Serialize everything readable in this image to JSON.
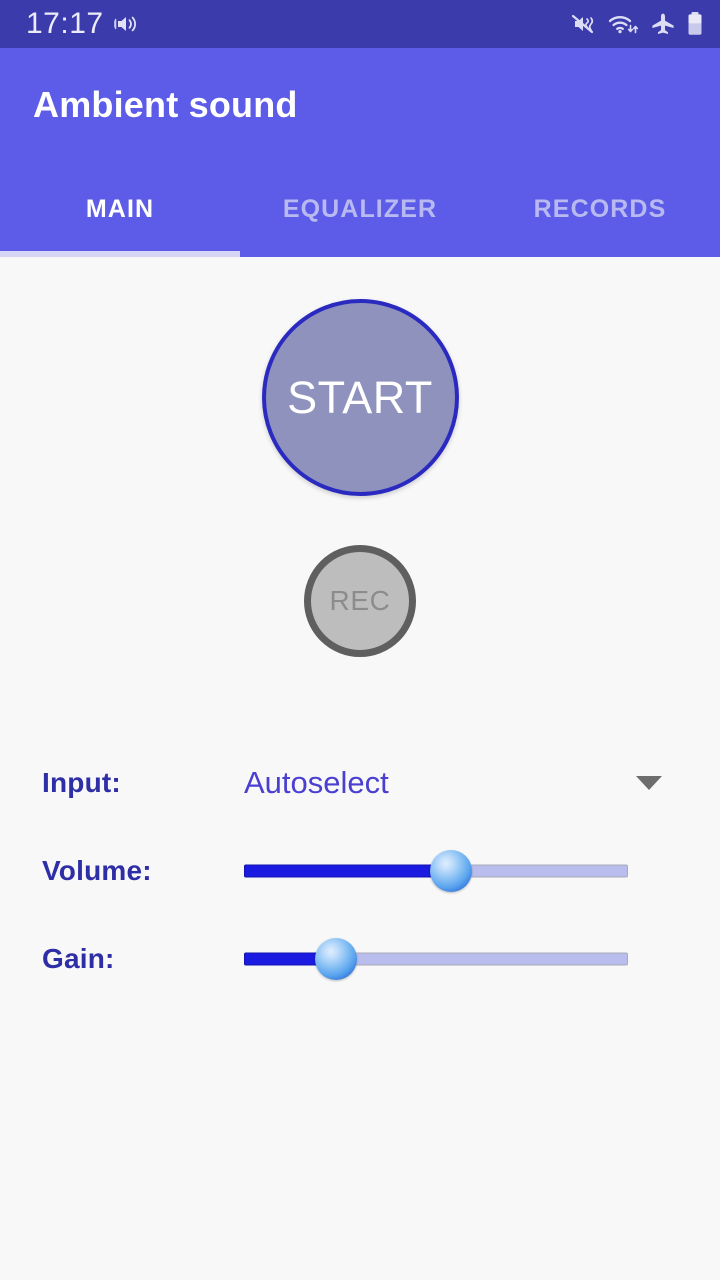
{
  "status_bar": {
    "clock": "17:17",
    "left_icons": [
      "sound-waves-icon"
    ],
    "right_icons": [
      "mute-vibrate-icon",
      "wifi-data-icon",
      "airplane-mode-icon",
      "battery-icon"
    ],
    "background": "#3b3bab"
  },
  "app_bar": {
    "title": "Ambient sound",
    "background": "#5c5ce8",
    "title_color": "#ffffff"
  },
  "tabs": {
    "items": [
      {
        "label": "MAIN",
        "active": true
      },
      {
        "label": "EQUALIZER",
        "active": false
      },
      {
        "label": "RECORDS",
        "active": false
      }
    ],
    "active_color": "#ffffff",
    "inactive_color": "#b9b9f2",
    "indicator_color": "#d6d6f4"
  },
  "main": {
    "start_button": {
      "label": "START",
      "fill": "#8e92bd",
      "border": "#2a2ac0",
      "text_color": "#ffffff"
    },
    "rec_button": {
      "label": "REC",
      "fill": "#bdbdbd",
      "border": "#5f5f5f",
      "text_color": "#8c8c8c"
    },
    "controls": [
      {
        "label": "Input:",
        "type": "select",
        "value": "Autoselect"
      },
      {
        "label": "Volume:",
        "type": "slider",
        "percent": 54
      },
      {
        "label": "Gain:",
        "type": "slider",
        "percent": 24
      }
    ],
    "label_color": "#2e2ea6",
    "value_color": "#4a3fd0",
    "slider_fill_color": "#1a1ae0",
    "slider_track_color": "#b9bdee",
    "background": "#f8f8f9"
  }
}
